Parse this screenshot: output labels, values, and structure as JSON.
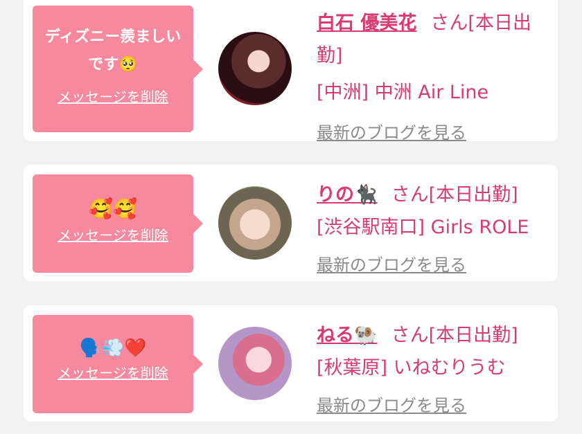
{
  "messages": [
    {
      "text": "ディズニー羨ましいです🥺",
      "delete_label": "メッセージを削除",
      "name": "白石 優美花",
      "suffix": "さん[本日出勤]",
      "shop": "[中洲] 中洲 Air Line",
      "blog_link": "最新のブログを見る"
    },
    {
      "text": "🥰🥰",
      "delete_label": "メッセージを削除",
      "name": "りの🐈‍⬛",
      "suffix": "さん[本日出勤]",
      "shop": "[渋谷駅南口] Girls ROLE",
      "blog_link": "最新のブログを見る"
    },
    {
      "text": "🗣️💨❤️",
      "delete_label": "メッセージを削除",
      "name": "ねる🐏",
      "suffix": "さん[本日出勤]",
      "shop": "[秋葉原] いねむりうむ",
      "blog_link": "最新のブログを見る"
    }
  ],
  "colors": {
    "accent": "#d63c6e",
    "bubble": "#f7899f",
    "background": "#f2f2f2",
    "muted_link": "#8a8a8a"
  }
}
